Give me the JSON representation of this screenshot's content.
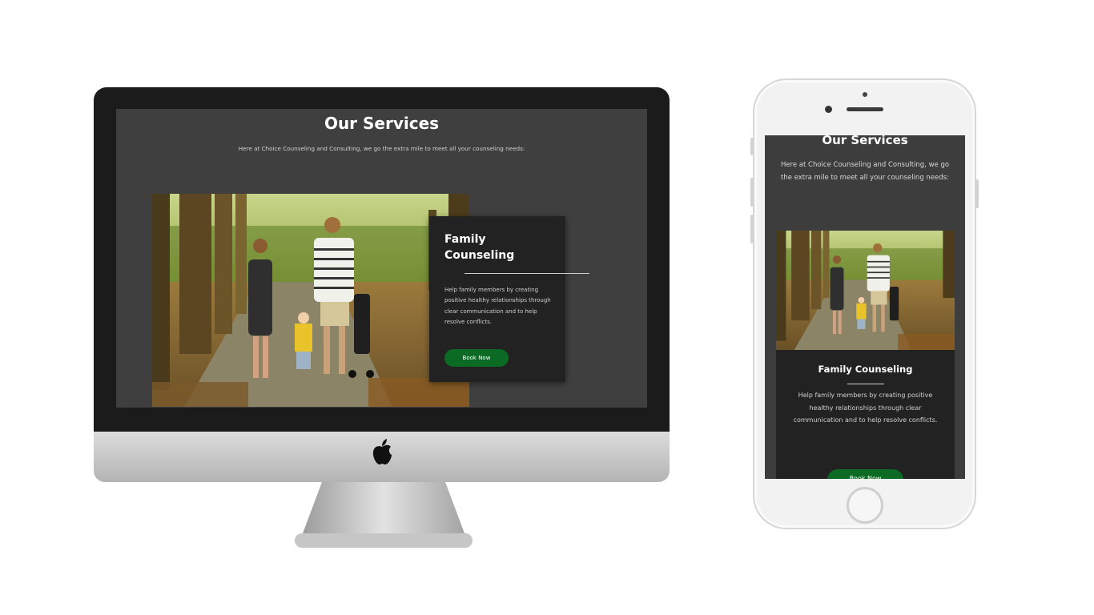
{
  "desktop": {
    "title": "Our Services",
    "subtitle": "Here at Choice Counseling and Consulting, we go the extra mile to meet all your counseling needs:",
    "card": {
      "title": "Family Counseling",
      "description": "Help family members by creating positive healthy relationships through clear communication and to help resolve conflicts.",
      "button": "Book Now"
    }
  },
  "mobile": {
    "title": "Our Services",
    "subtitle": "Here at Choice Counseling and Consulting, we go the extra mile to meet all your counseling needs:",
    "card": {
      "title": "Family Counseling",
      "description": "Help family members by creating positive healthy relationships through clear communication and to help resolve conflicts.",
      "button": "Book Now"
    }
  },
  "colors": {
    "section_bg": "#3f3f3f",
    "card_bg": "#222222",
    "button_bg": "#0b6b24",
    "text": "#ffffff"
  },
  "icons": [
    "apple-logo-icon"
  ]
}
